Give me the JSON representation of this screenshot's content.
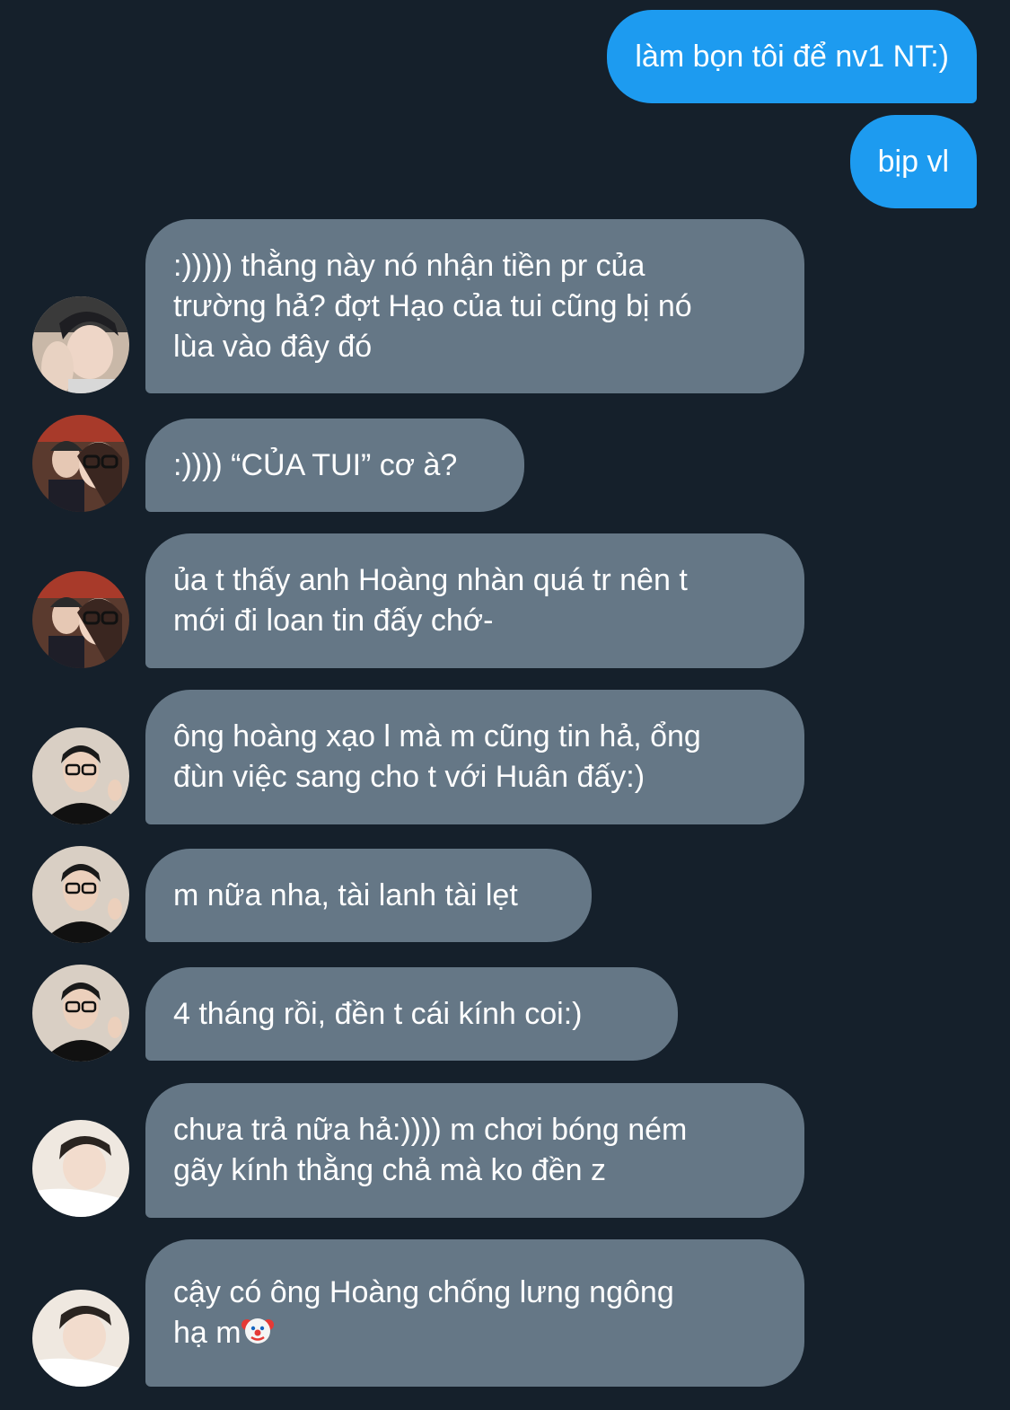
{
  "conversation": {
    "messages": [
      {
        "from": "me",
        "lines": [
          "làm bọn tôi để nv1 NT:)"
        ]
      },
      {
        "from": "me",
        "lines": [
          "bịp vl"
        ]
      },
      {
        "from": "user_a",
        "lines": [
          ":))))) thằng này nó nhận tiền pr của",
          "trường hả? đợt Hạo của tui cũng bị nó",
          "lùa vào đây đó"
        ]
      },
      {
        "from": "user_b",
        "lines": [
          ":)))) “CỦA TUI” cơ à?"
        ]
      },
      {
        "from": "user_b",
        "lines": [
          "ủa t thấy anh Hoàng nhàn quá tr nên t",
          "mới đi loan tin đấy chớ-"
        ]
      },
      {
        "from": "user_c",
        "lines": [
          "ông hoàng xạo l mà m cũng tin hả, ổng",
          "đùn việc sang cho t với Huân đấy:)"
        ]
      },
      {
        "from": "user_c",
        "lines": [
          "m nữa nha, tài lanh tài lẹt"
        ]
      },
      {
        "from": "user_c",
        "lines": [
          "4 tháng rồi, đền t cái kính coi:)"
        ]
      },
      {
        "from": "user_d",
        "lines": [
          "chưa trả nữa hả:)))) m chơi bóng ném",
          "gãy kính thằng chả  mà ko đền z"
        ]
      },
      {
        "from": "user_d",
        "lines": [
          "cậy có ông Hoàng chống lưng ngông",
          "hạ m"
        ],
        "trailing_emoji": "clown-face-emoji"
      }
    ]
  },
  "colors": {
    "background": "#15202b",
    "sent_bubble": "#1d9bf0",
    "received_bubble": "#657786",
    "text": "#ffffff"
  }
}
